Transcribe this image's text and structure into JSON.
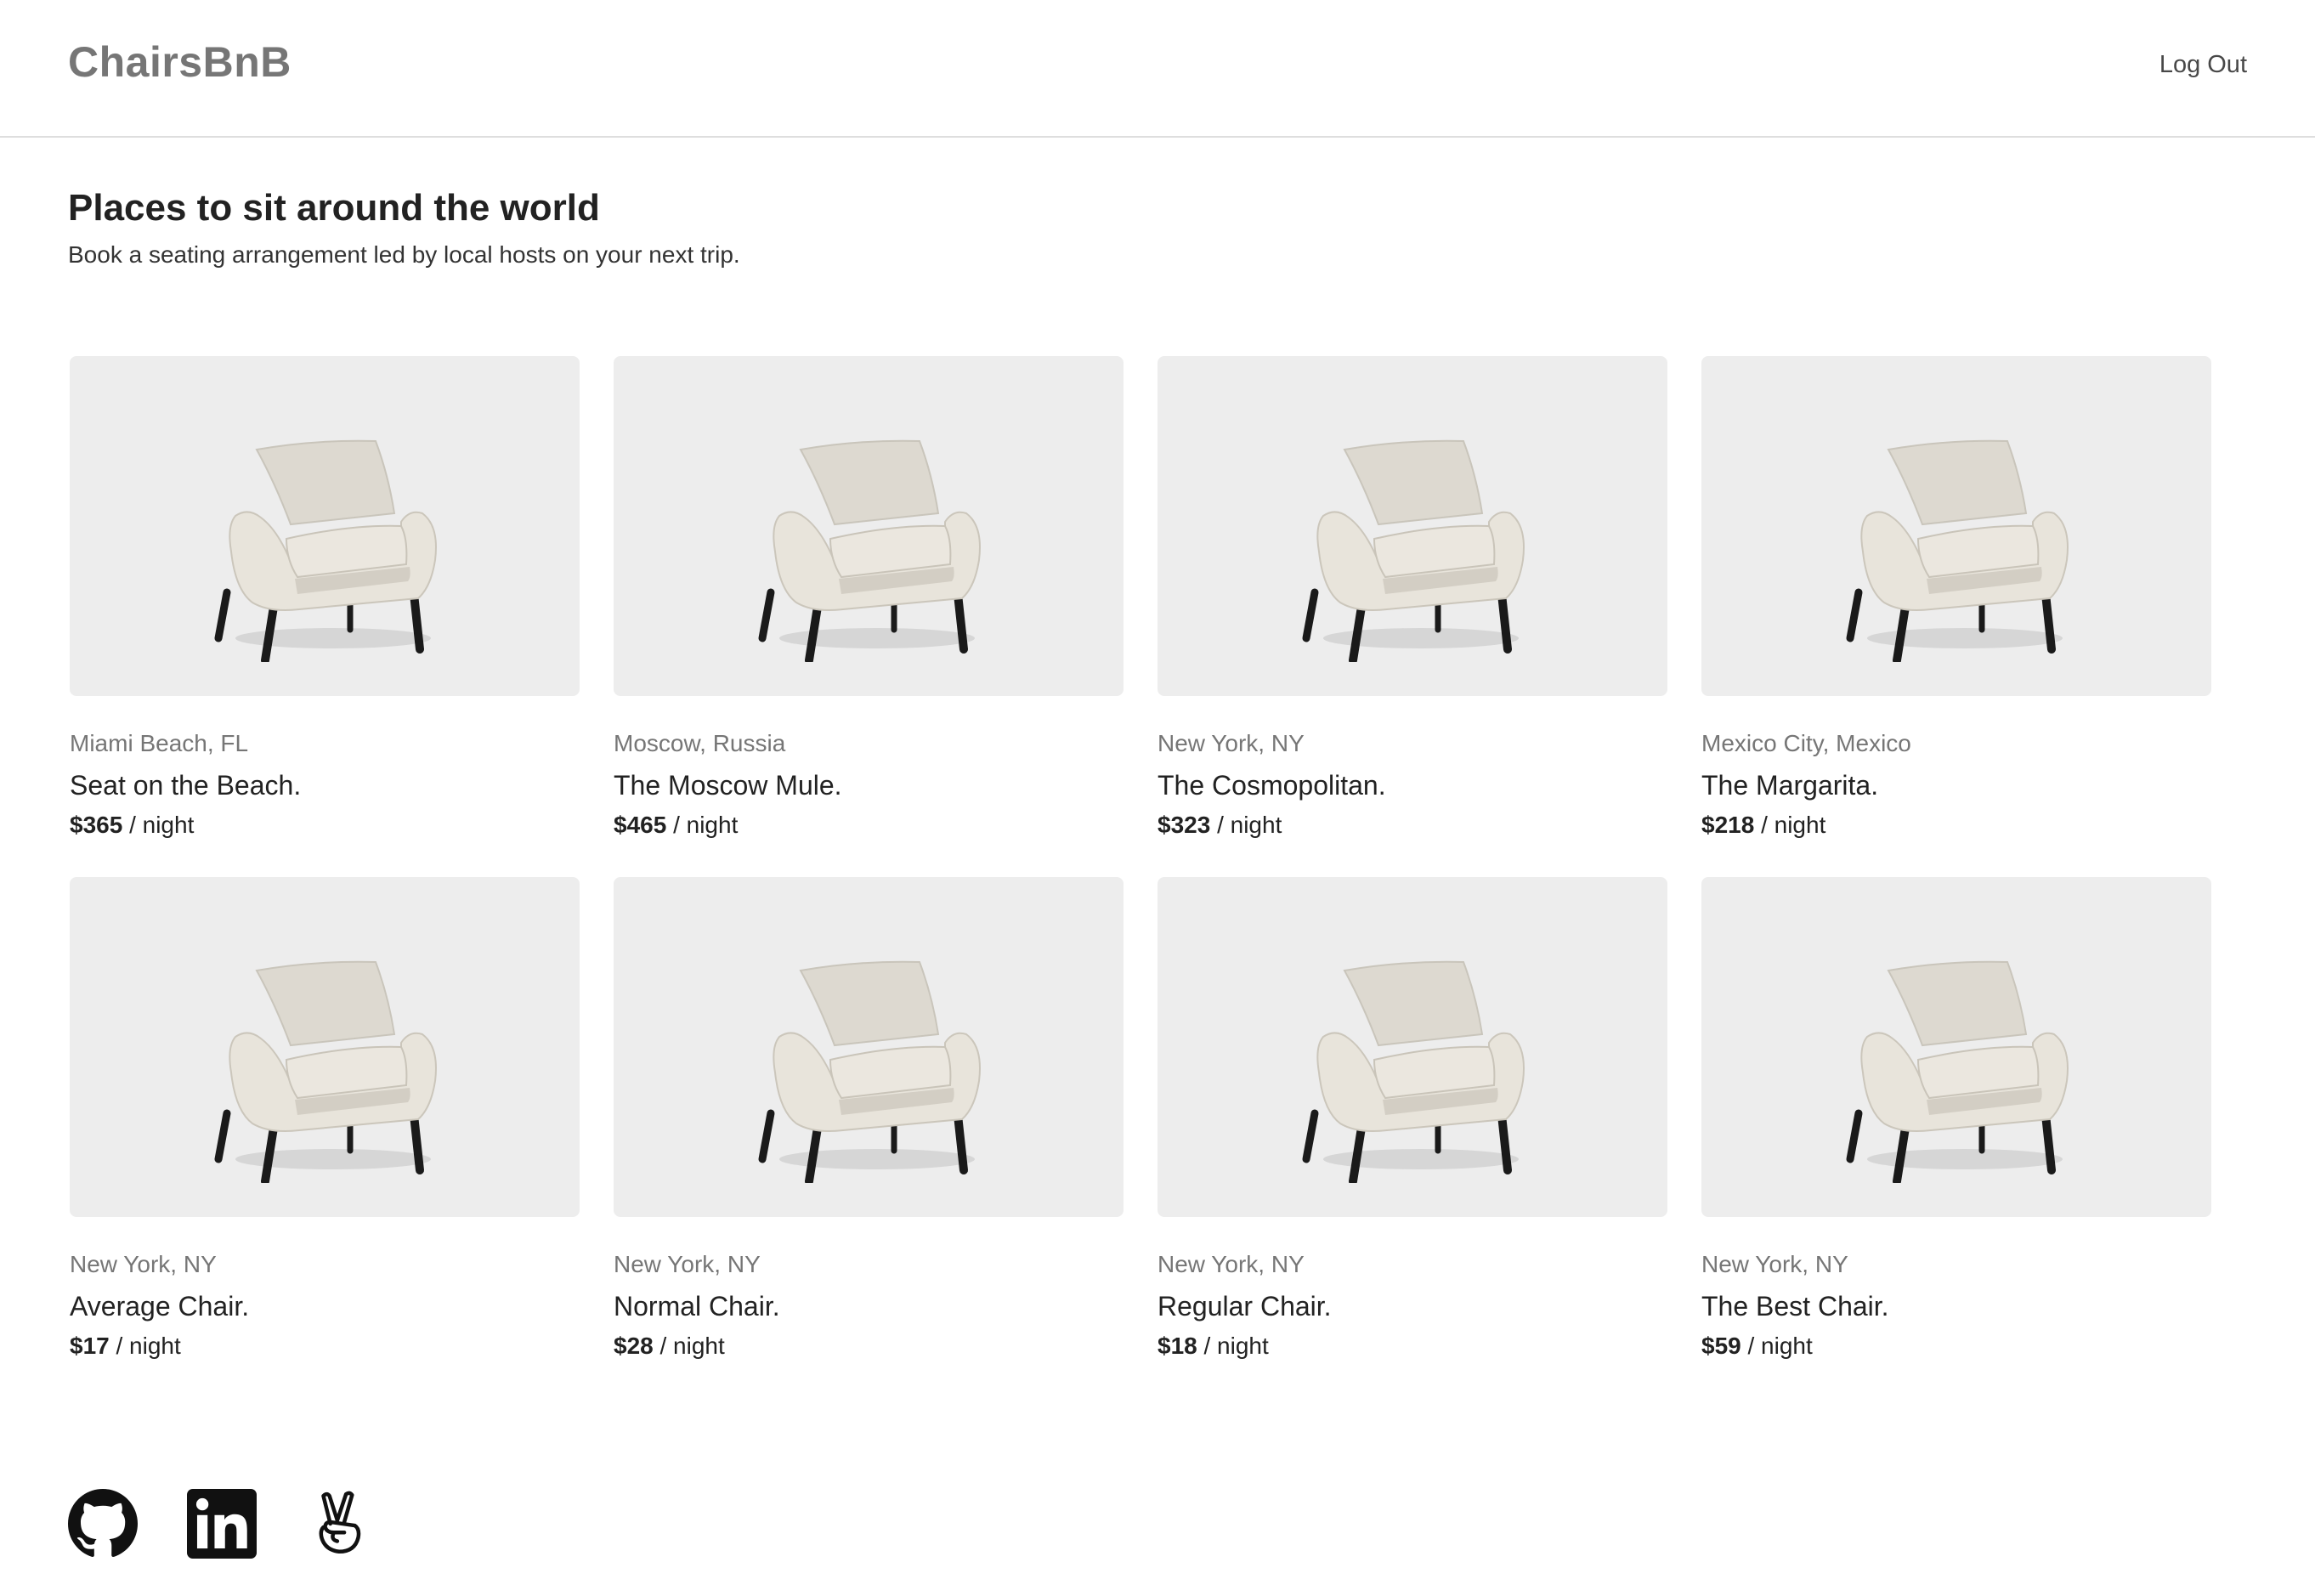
{
  "header": {
    "brand": "ChairsBnB",
    "logout_label": "Log Out"
  },
  "hero": {
    "title": "Places to sit around the world",
    "subtitle": "Book a seating arrangement led by local hosts on your next trip."
  },
  "listings": [
    {
      "location": "Miami Beach, FL",
      "name": "Seat on the Beach.",
      "price": "$365",
      "unit": " / night"
    },
    {
      "location": "Moscow, Russia",
      "name": "The Moscow Mule.",
      "price": "$465",
      "unit": " / night"
    },
    {
      "location": "New York, NY",
      "name": "The Cosmopolitan.",
      "price": "$323",
      "unit": " / night"
    },
    {
      "location": "Mexico City, Mexico",
      "name": "The Margarita.",
      "price": "$218",
      "unit": " / night"
    },
    {
      "location": "New York, NY",
      "name": "Average Chair.",
      "price": "$17",
      "unit": " / night"
    },
    {
      "location": "New York, NY",
      "name": "Normal Chair.",
      "price": "$28",
      "unit": " / night"
    },
    {
      "location": "New York, NY",
      "name": "Regular Chair.",
      "price": "$18",
      "unit": " / night"
    },
    {
      "location": "New York, NY",
      "name": "The Best Chair.",
      "price": "$59",
      "unit": " / night"
    }
  ],
  "footer": {
    "icons": [
      "github-icon",
      "linkedin-icon",
      "angellist-icon"
    ]
  }
}
